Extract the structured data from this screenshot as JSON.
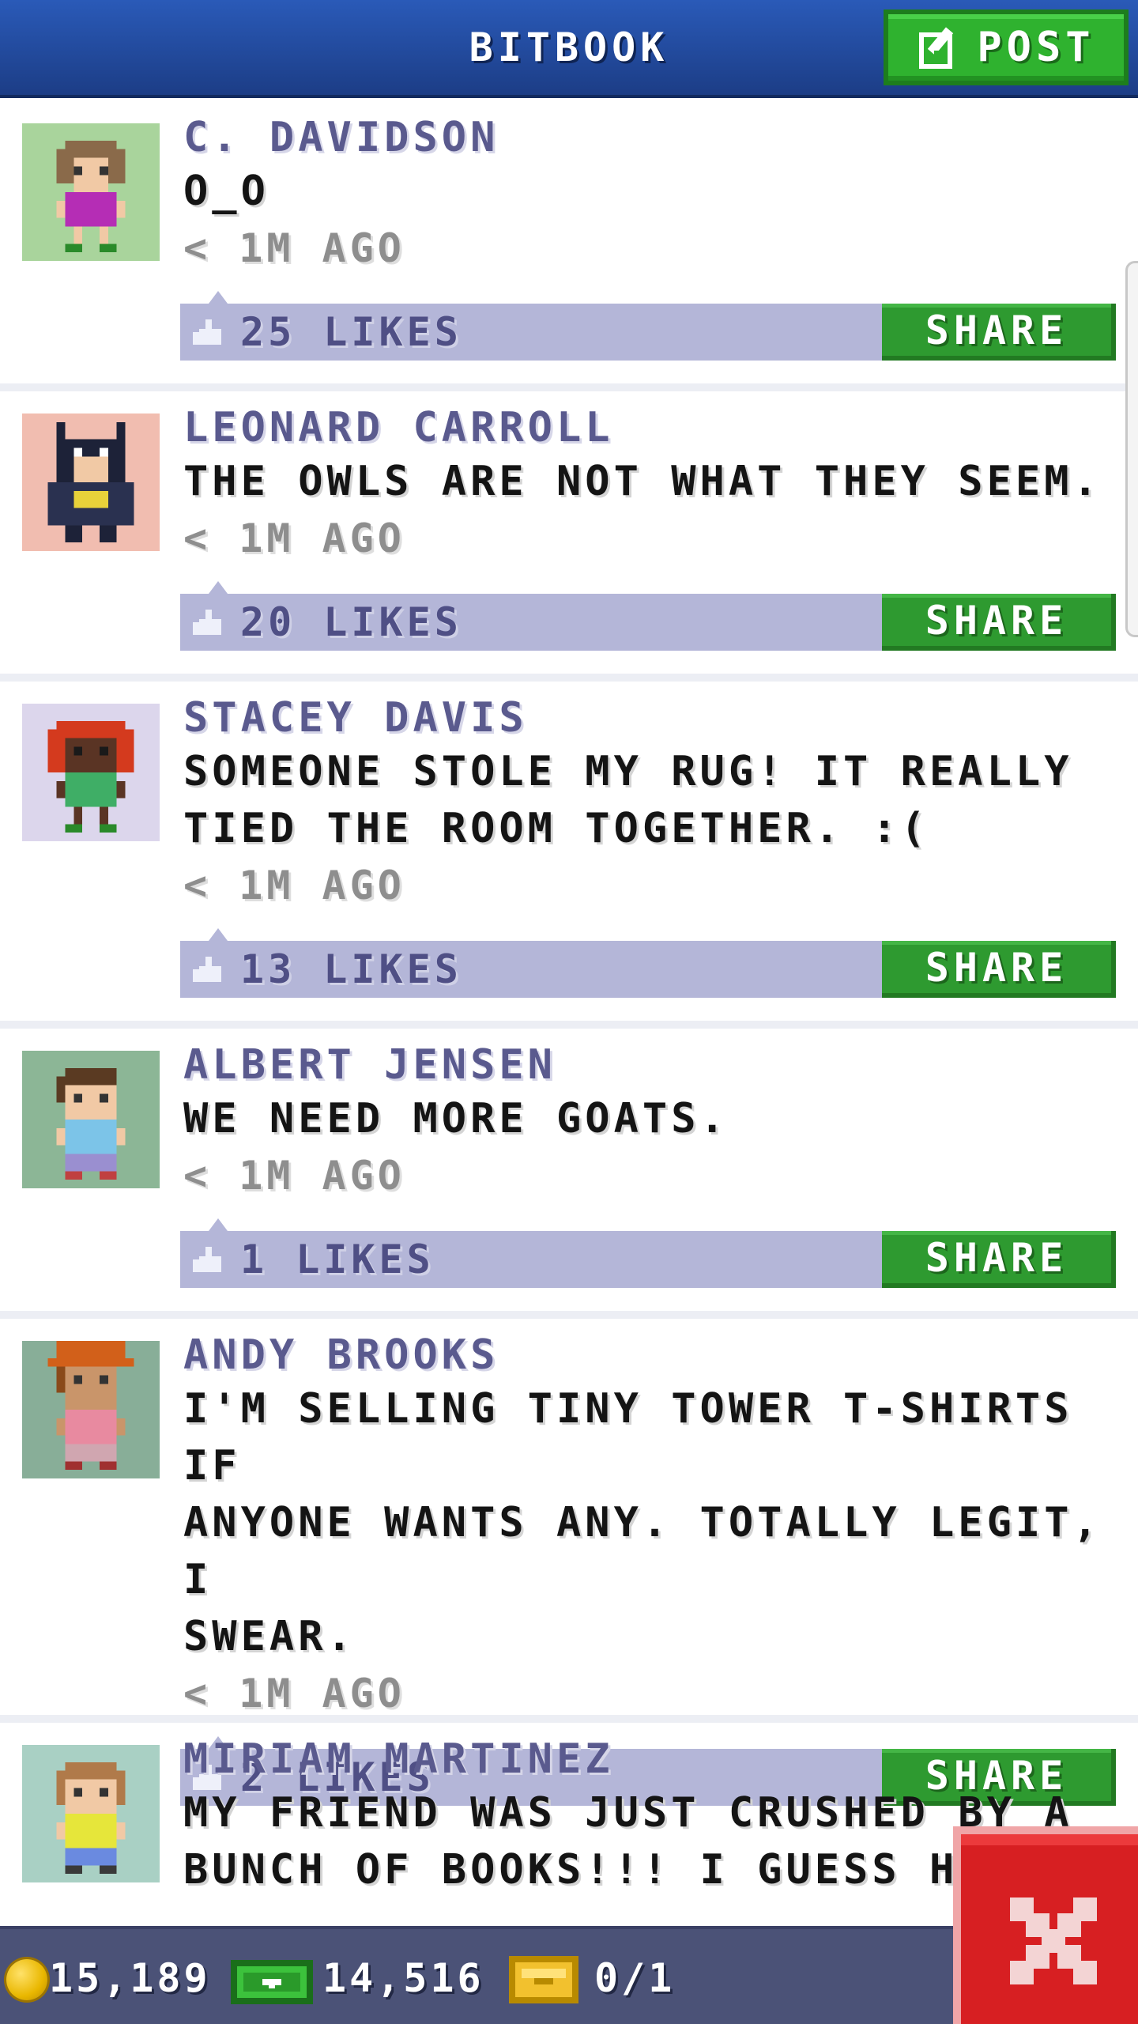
{
  "header": {
    "title": "BITBOOK",
    "post_label": "POST"
  },
  "posts": [
    {
      "name": "C. DAVIDSON",
      "message": "O_O",
      "time": "< 1M AGO",
      "likes": "25 LIKES",
      "share_label": "SHARE",
      "avatar_bg": "#a9d49c",
      "avatar_style": "girl-purple-shirt"
    },
    {
      "name": "LEONARD CARROLL",
      "message": "THE OWLS ARE NOT WHAT THEY SEEM.",
      "time": "< 1M AGO",
      "likes": "20 LIKES",
      "share_label": "SHARE",
      "avatar_bg": "#f1bdb0",
      "avatar_style": "batman-costume"
    },
    {
      "name": "STACEY DAVIS",
      "message": "SOMEONE STOLE MY RUG! IT REALLY\nTIED THE ROOM TOGETHER. :(",
      "time": "< 1M AGO",
      "likes": "13 LIKES",
      "share_label": "SHARE",
      "avatar_bg": "#dcd6ec",
      "avatar_style": "red-hair-green-shirt"
    },
    {
      "name": "ALBERT JENSEN",
      "message": "WE NEED MORE GOATS.",
      "time": "< 1M AGO",
      "likes": "1 LIKES",
      "share_label": "SHARE",
      "avatar_bg": "#8cb696",
      "avatar_style": "boy-blue-shirt"
    },
    {
      "name": "ANDY BROOKS",
      "message": "I'M SELLING TINY TOWER T-SHIRTS IF\nANYONE WANTS ANY. TOTALLY LEGIT, I\nSWEAR.",
      "time": "< 1M AGO",
      "likes": "2 LIKES",
      "share_label": "SHARE",
      "avatar_bg": "#88ae98",
      "avatar_style": "orange-hat-pink-shirt"
    },
    {
      "name": "MIRIAM MARTINEZ",
      "message": "MY FRIEND WAS JUST CRUSHED BY A\nBUNCH OF BOOKS!!! I GUESS HE O",
      "time": "",
      "likes": "",
      "share_label": "",
      "avatar_bg": "#a9d0c4",
      "avatar_style": "girl-yellow-shirt"
    }
  ],
  "status_bar": {
    "coins": "15,189",
    "bux": "14,516",
    "tickets": "0/1"
  },
  "colors": {
    "header_blue": "#2a5ab8",
    "share_green": "#2e9a30",
    "like_bar": "#b4b6d8",
    "close_red": "#d71f22"
  },
  "icons": {
    "post": "edit-icon",
    "like": "thumbs-up-icon",
    "coin": "coin-icon",
    "cash": "cash-icon",
    "ticket": "ticket-icon",
    "close": "close-icon"
  }
}
